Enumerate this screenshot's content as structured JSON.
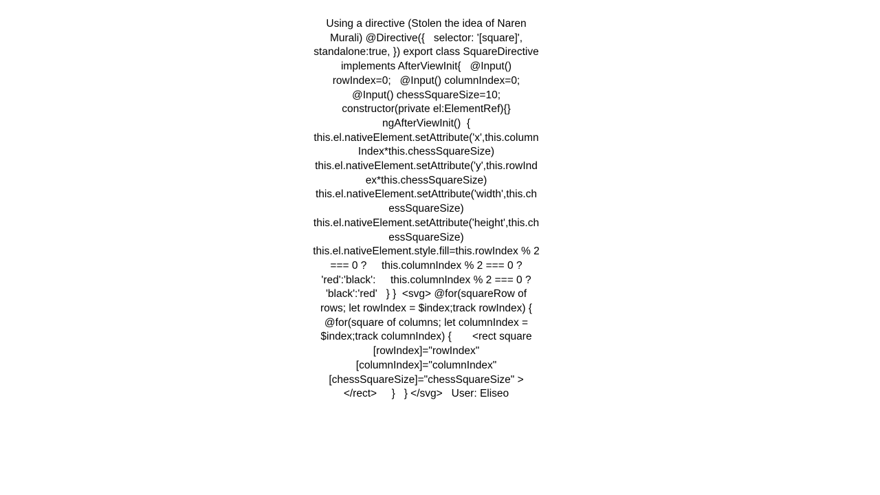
{
  "page": {
    "background_color": "#ffffff",
    "text_color": "#000000"
  },
  "document": {
    "intro": "Using a directive (Stolen the idea of Naren Murali)",
    "author_credit": "Naren Murali",
    "user_label": "User: Eliseo",
    "user_name": "Eliseo",
    "body": "Using a directive (Stolen the idea of Naren Murali) @Directive({   selector: '[square]',   standalone:true, }) export class SquareDirective implements AfterViewInit{   @Input() rowIndex=0;   @Input() columnIndex=0;   @Input() chessSquareSize=10;   constructor(private el:ElementRef){}   ngAfterViewInit()  {     this.el.nativeElement.setAttribute('x',this.columnIndex*this.chessSquareSize)     this.el.nativeElement.setAttribute('y',this.rowIndex*this.chessSquareSize)     this.el.nativeElement.setAttribute('width',this.chessSquareSize)     this.el.nativeElement.setAttribute('height',this.chessSquareSize)     this.el.nativeElement.style.fill=this.rowIndex % 2 === 0 ?     this.columnIndex % 2 === 0 ?     'red':'black':     this.columnIndex % 2 === 0 ?     'black':'red'   } }  <svg> @for(squareRow of rows; let rowIndex = $index;track rowIndex) {     @for(square of columns; let columnIndex = $index;track columnIndex) {       <rect square [rowIndex]=\"rowIndex\" [columnIndex]=\"columnIndex\" [chessSquareSize]=\"chessSquareSize\" >     </rect>     }   } </svg>   User: Eliseo",
    "code_fragments": {
      "directive_decorator": "@Directive({   selector: '[square]',   standalone:true, })",
      "class_declaration": "export class SquareDirective implements AfterViewInit{",
      "inputs": [
        "@Input() rowIndex=0;",
        "@Input() columnIndex=0;",
        "@Input() chessSquareSize=10;"
      ],
      "constructor": "constructor(private el:ElementRef){}",
      "lifecycle_hook": "ngAfterViewInit()  {",
      "set_attribute_calls": [
        "this.el.nativeElement.setAttribute('x',this.columnIndex*this.chessSquareSize)",
        "this.el.nativeElement.setAttribute('y',this.rowIndex*this.chessSquareSize)",
        "this.el.nativeElement.setAttribute('width',this.chessSquareSize)",
        "this.el.nativeElement.setAttribute('height',this.chessSquareSize)"
      ],
      "fill_expression": "this.el.nativeElement.style.fill=this.rowIndex % 2 === 0 ?     this.columnIndex % 2 === 0 ?     'red':'black':     this.columnIndex % 2 === 0 ?     'black':'red'",
      "template_svg_open": "<svg>",
      "template_for_rows": "@for(squareRow of rows; let rowIndex = $index;track rowIndex) {",
      "template_for_columns": "@for(square of columns; let columnIndex = $index;track columnIndex) {",
      "template_rect": "<rect square [rowIndex]=\"rowIndex\" [columnIndex]=\"columnIndex\" [chessSquareSize]=\"chessSquareSize\" >",
      "template_rect_close": "</rect>",
      "template_svg_close": "</svg>",
      "colors_used": [
        "red",
        "black"
      ],
      "default_chess_square_size": "10",
      "default_row_index": "0",
      "default_column_index": "0"
    }
  }
}
